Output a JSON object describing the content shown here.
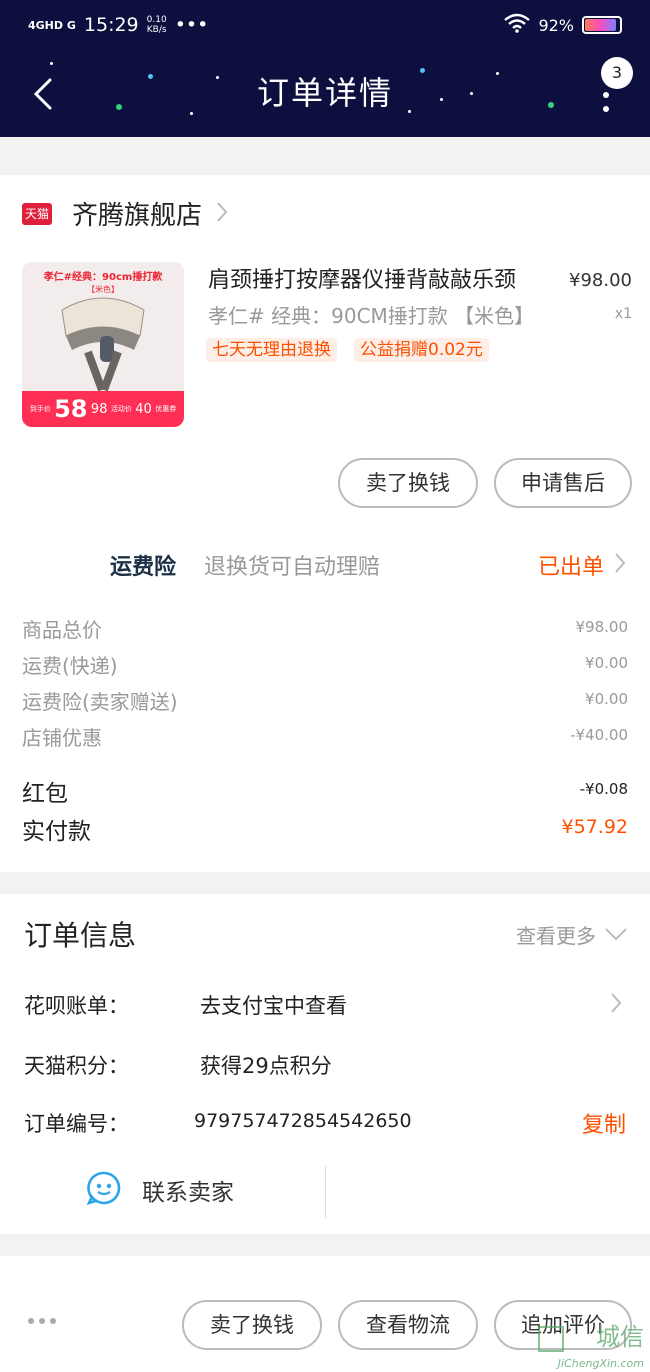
{
  "status_bar": {
    "network": "4GHD G",
    "time": "15:29",
    "speed_value": "0.10",
    "speed_unit": "KB/s",
    "more": "•••",
    "battery": "92%"
  },
  "header": {
    "title": "订单详情",
    "badge_count": "3"
  },
  "store": {
    "badge": "天猫",
    "name": "齐腾旗舰店"
  },
  "product": {
    "title": "肩颈捶打按摩器仪捶背敲敲乐颈",
    "spec": "孝仁# 经典：90CM捶打款 【米色】",
    "price": "¥98.00",
    "qty": "x1",
    "tags": [
      "七天无理由退换",
      "公益捐赠0.02元"
    ],
    "thumb": {
      "top_text": "孝仁#经典：90cm捶打款",
      "sub_text": "【米色】",
      "price_big": "58",
      "price_mid": "98",
      "price_mid_label": "活动价",
      "price_small": "40",
      "price_small_label": "优惠券",
      "price_big_label": "到手价"
    }
  },
  "item_actions": {
    "sell_label": "卖了换钱",
    "aftersale_label": "申请售后"
  },
  "insurance": {
    "label": "运费险",
    "desc": "退换货可自动理赔",
    "status": "已出单"
  },
  "costs": [
    {
      "label": "商品总价",
      "value": "¥98.00"
    },
    {
      "label": "运费(快递)",
      "value": "¥0.00"
    },
    {
      "label": "运费险(卖家赠送)",
      "value": "¥0.00"
    },
    {
      "label": "店铺优惠",
      "value": "-¥40.00"
    }
  ],
  "red_packet": {
    "label": "红包",
    "value": "-¥0.08"
  },
  "paid": {
    "label": "实付款",
    "value": "¥57.92"
  },
  "order_info": {
    "title": "订单信息",
    "see_more": "查看更多",
    "rows": [
      {
        "label": "花呗账单：",
        "value": "去支付宝中查看"
      },
      {
        "label": "天猫积分：",
        "value": "获得29点积分"
      },
      {
        "label": "订单编号：",
        "value": "979757472854542650"
      }
    ],
    "copy_label": "复制",
    "contact_label": "联系卖家"
  },
  "bottom_bar": {
    "sell_label": "卖了换钱",
    "logistics_label": "查看物流",
    "review_label": "追加评价"
  },
  "watermark": {
    "cn": "城信",
    "en": "JiChengXin.com"
  }
}
